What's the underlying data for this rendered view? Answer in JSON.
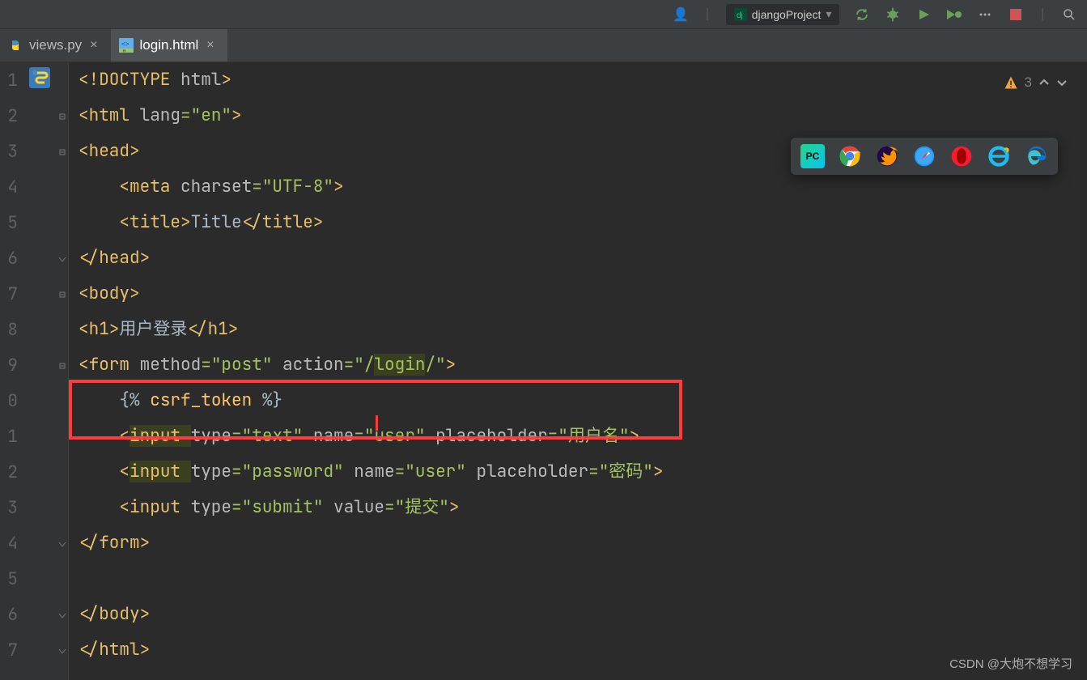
{
  "toolbar": {
    "run_config": "djangoProject",
    "icons": [
      "user",
      "sync",
      "bug",
      "run",
      "run-dbg",
      "more",
      "stop"
    ]
  },
  "tabs": [
    {
      "label": "views.py",
      "active": false,
      "type": "py"
    },
    {
      "label": "login.html",
      "active": true,
      "type": "html"
    }
  ],
  "inspection": {
    "warning_count": "3"
  },
  "browsers": [
    "pycharm",
    "chrome",
    "firefox",
    "safari",
    "opera",
    "ie",
    "edge"
  ],
  "line_numbers": [
    "1",
    "2",
    "3",
    "4",
    "5",
    "6",
    "7",
    "8",
    "9",
    "0",
    "1",
    "2",
    "3",
    "4",
    "5",
    "6",
    "7"
  ],
  "code": {
    "l1": {
      "a": "<!",
      "b": "DOCTYPE ",
      "c": "html",
      "d": ">"
    },
    "l2": {
      "a": "<html ",
      "b": "lang",
      "c": "=",
      "d": "\"en\"",
      "e": ">"
    },
    "l3": {
      "a": "<head>"
    },
    "l4": {
      "a": "<meta ",
      "b": "charset",
      "c": "=",
      "d": "\"UTF-8\"",
      "e": ">"
    },
    "l5": {
      "a": "<title>",
      "b": "Title",
      "c": "</title>"
    },
    "l6": {
      "a": "</head>"
    },
    "l7": {
      "a": "<body>"
    },
    "l8": {
      "a": "<h1>",
      "b": "用户登录",
      "c": "</h1>"
    },
    "l9": {
      "a": "<form ",
      "b": "method",
      "c": "=",
      "d": "\"post\" ",
      "e": "action",
      "f": "=",
      "g": "\"/",
      "h": "login",
      "i": "/\"",
      "j": ">"
    },
    "l10": {
      "a": "{% ",
      "b": "csrf_token ",
      "c": "%}"
    },
    "l11": {
      "a": "<",
      "b": "input ",
      "c": "type",
      "d": "=",
      "e": "\"text\" ",
      "f": "name",
      "g": "=",
      "h": "\"user\" ",
      "i": "placeholder",
      "j": "=",
      "k": "\"用户名\"",
      "l": ">"
    },
    "l12": {
      "a": "<",
      "b": "input ",
      "c": "type",
      "d": "=",
      "e": "\"password\" ",
      "f": "name",
      "g": "=",
      "h": "\"user\" ",
      "i": "placeholder",
      "j": "=",
      "k": "\"密码\"",
      "l": ">"
    },
    "l13": {
      "a": "<input ",
      "b": "type",
      "c": "=",
      "d": "\"submit\" ",
      "e": "value",
      "f": "=",
      "g": "\"提交\"",
      "h": ">"
    },
    "l14": {
      "a": "</form>"
    },
    "l15": {
      "a": ""
    },
    "l16": {
      "a": "</body>"
    },
    "l17": {
      "a": "</html>"
    }
  },
  "watermark": "CSDN @大炮不想学习"
}
